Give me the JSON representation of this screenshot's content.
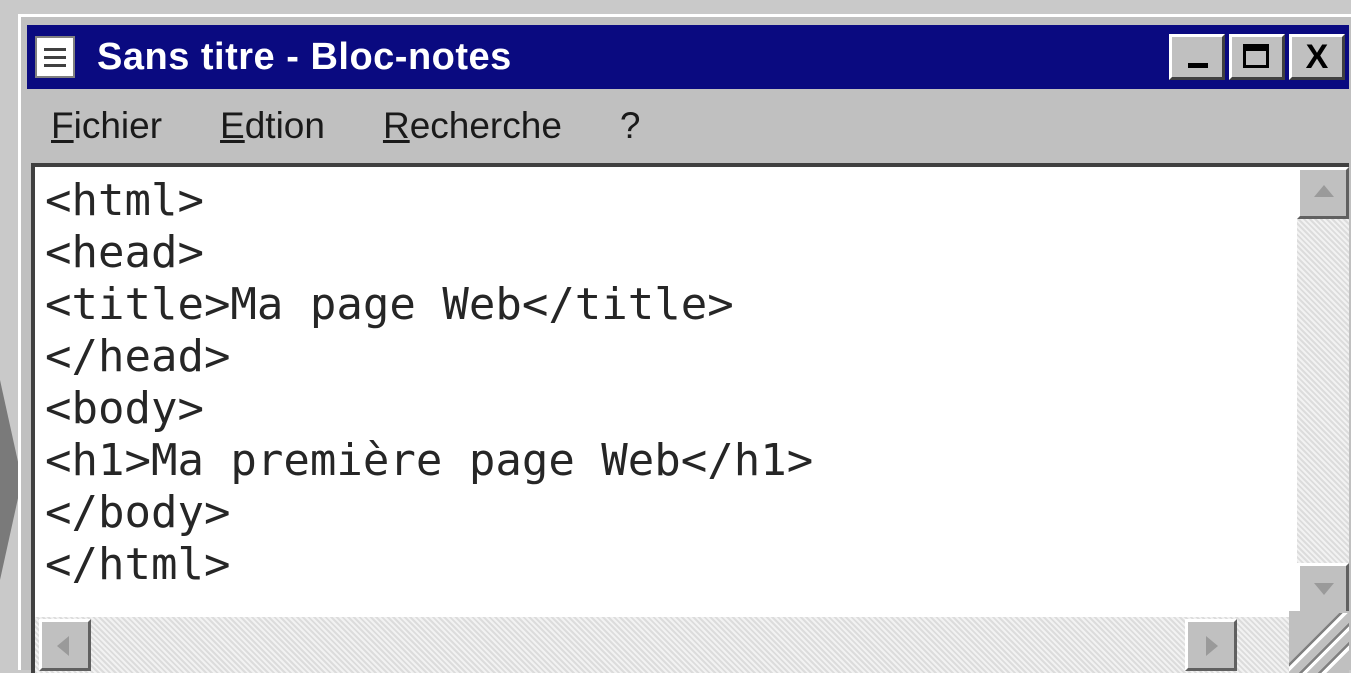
{
  "window": {
    "title": "Sans titre - Bloc-notes",
    "controls": {
      "minimize": "_",
      "maximize": "□",
      "close": "X"
    }
  },
  "menubar": {
    "items": [
      "Fichier",
      "Edtion",
      "Recherche",
      "?"
    ]
  },
  "editor": {
    "content": "<html>\n<head>\n<title>Ma page Web</title>\n</head>\n<body>\n<h1>Ma première page Web</h1>\n</body>\n</html>"
  },
  "icons": {
    "app": "notepad-icon",
    "scroll_up": "arrow-up-icon",
    "scroll_down": "arrow-down-icon",
    "scroll_left": "arrow-left-icon",
    "scroll_right": "arrow-right-icon",
    "resize": "resize-grip-icon"
  },
  "colors": {
    "titlebar": "#0a0a80",
    "chrome": "#c0c0c0",
    "editor_bg": "#ffffff",
    "text": "#262626"
  }
}
